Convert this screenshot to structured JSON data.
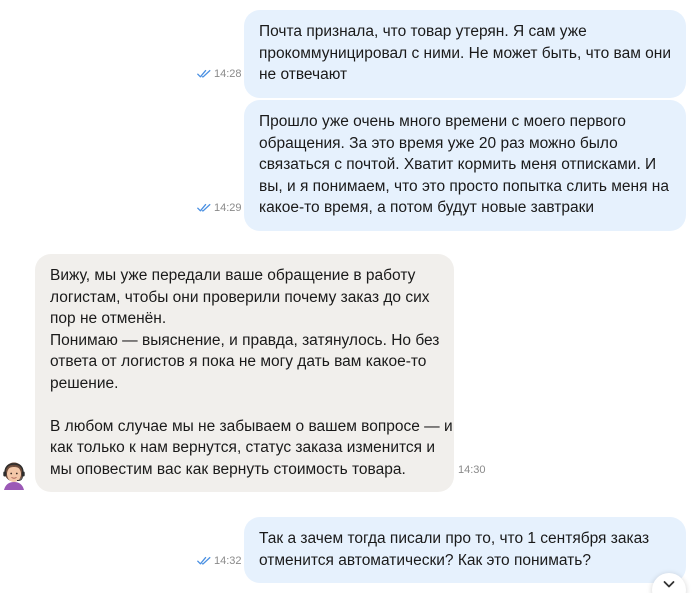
{
  "messages": [
    {
      "direction": "outgoing",
      "status": "read",
      "time": "14:28",
      "lines": [
        "Почта признала, что товар утерян. Я сам уже",
        "прокоммуницировал с ними. Не может быть, что вам они",
        "не отвечают"
      ]
    },
    {
      "direction": "outgoing",
      "status": "read",
      "time": "14:29",
      "lines": [
        "Прошло уже очень много времени с моего первого",
        "обращения. За это время уже 20 раз можно было",
        "связаться с почтой. Хватит кормить меня отписками. И",
        "вы, и я понимаем, что это просто попытка слить меня на",
        "какое-то время, а потом будут новые завтраки"
      ]
    },
    {
      "direction": "incoming",
      "time": "14:30",
      "lines": [
        "Вижу, мы уже передали ваше обращение в работу",
        "логистам, чтобы они проверили почему заказ до сих",
        "пор не отменён.",
        "Понимаю — выяснение, и правда, затянулось. Но без",
        "ответа от логистов я пока не могу дать вам какое-то",
        "решение.",
        "",
        "В любом случае мы не забываем о вашем вопросе — и",
        "как только к нам вернутся, статус заказа изменится и",
        "мы оповестим вас как вернуть стоимость товара."
      ]
    },
    {
      "direction": "outgoing",
      "status": "read",
      "time": "14:32",
      "lines": [
        "Так а зачем тогда писали про то, что 1 сентября заказ",
        "отменится автоматически? Как это понимать?"
      ]
    }
  ],
  "icons": {
    "read_ticks": "double-check-icon",
    "avatar": "support-agent-avatar",
    "scroll_down": "chevron-down-icon"
  },
  "colors": {
    "outgoing_bubble": "#e6f1fd",
    "incoming_bubble": "#f1efec",
    "read_ticks": "#4a90e2",
    "time_text": "#8a8a8a"
  }
}
